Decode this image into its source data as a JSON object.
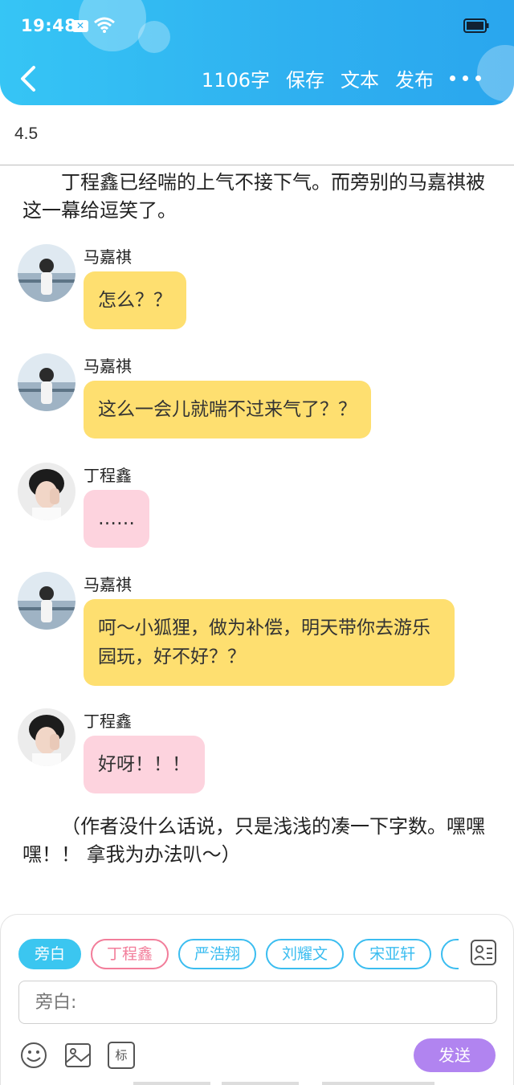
{
  "status": {
    "time": "19:48"
  },
  "header": {
    "word_count": "1106字",
    "save_label": "保存",
    "text_label": "文本",
    "publish_label": "发布",
    "accent": "#2fb1f0"
  },
  "doc_title": "4.5",
  "narrations": [
    "丁程鑫已经喘的上气不接下气。而旁别的马嘉祺被这一幕给逗笑了。",
    "（作者没什么话说，只是浅浅的凑一下字数。嘿嘿嘿！！ 拿我为办法叭～）"
  ],
  "messages": [
    {
      "speaker": "马嘉祺",
      "text": "怎么？？",
      "color": "yellow"
    },
    {
      "speaker": "马嘉祺",
      "text": "这么一会儿就喘不过来气了？？",
      "color": "yellow"
    },
    {
      "speaker": "丁程鑫",
      "text": "……",
      "color": "pink"
    },
    {
      "speaker": "马嘉祺",
      "text": "呵～小狐狸，做为补偿，明天带你去游乐园玩，好不好？？",
      "color": "yellow"
    },
    {
      "speaker": "丁程鑫",
      "text": "好呀！！！",
      "color": "pink"
    }
  ],
  "composer": {
    "chips": [
      "旁白",
      "丁程鑫",
      "严浩翔",
      "刘耀文",
      "宋亚轩"
    ],
    "input_placeholder": "旁白:",
    "send_label": "发送",
    "icons": [
      "emoji-icon",
      "image-icon",
      "tag-icon",
      "contact-card-icon"
    ],
    "tag_icon_label": "标"
  }
}
